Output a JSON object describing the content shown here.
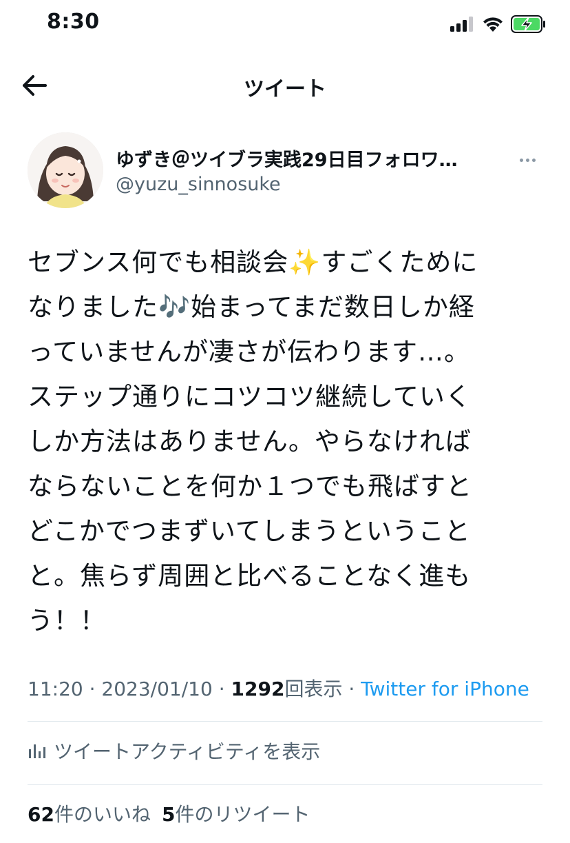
{
  "status_bar": {
    "time": "8:30",
    "icons": [
      "cellular-signal-icon",
      "wifi-icon",
      "battery-charging-icon"
    ]
  },
  "header": {
    "title": "ツイート"
  },
  "author": {
    "name": "ゆずき＠ツイブラ実践29日目フォロワ…",
    "handle": "@yuzu_sinnosuke"
  },
  "tweet": {
    "lines": [
      "セブンス何でも相談会✨すごくために",
      "なりました🎶始まってまだ数日しか経",
      "っていませんが凄さが伝わります…。",
      "ステップ通りにコツコツ継続していく",
      "しか方法はありません。やらなければ",
      "ならないことを何か１つでも飛ばすと",
      "どこかでつまずいてしまうということ",
      "と。焦らず周囲と比べることなく進も",
      "う！！"
    ]
  },
  "meta": {
    "time": "11:20",
    "date": "2023/01/10",
    "views_count": "1292",
    "views_label": "回表示",
    "separator": " · ",
    "source": "Twitter for iPhone"
  },
  "activity": {
    "label": "ツイートアクティビティを表示"
  },
  "stats": {
    "likes_count": "62",
    "likes_label": "件のいいね",
    "retweets_count": "5",
    "retweets_label": "件のリツイート"
  },
  "colors": {
    "text": "#0f1419",
    "secondary": "#536471",
    "link": "#1d9bf0",
    "divider": "#e1e8ed",
    "battery": "#4cd964"
  }
}
